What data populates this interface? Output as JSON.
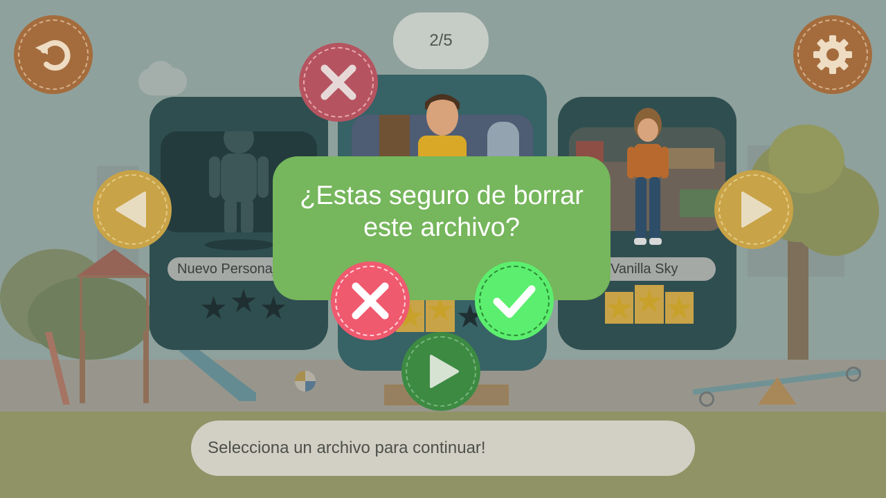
{
  "counter": {
    "text": "2/5"
  },
  "cards": [
    {
      "name": "Nuevo Personaje",
      "stars_filled": 0,
      "stars_total": 3
    },
    {
      "name": "",
      "stars_filled": 2,
      "stars_total": 3
    },
    {
      "name": "Vanilla Sky",
      "stars_filled": 3,
      "stars_total": 3
    }
  ],
  "dialog": {
    "question": "¿Estas seguro de borrar este archivo?",
    "cancel_icon": "cross-icon",
    "confirm_icon": "check-icon"
  },
  "hint": {
    "text": "Selecciona un archivo para continuar!"
  },
  "icons": {
    "top_left": "undo-icon",
    "top_right": "gear-icon",
    "delete": "cross-icon",
    "prev": "arrow-left-icon",
    "next": "arrow-right-icon",
    "play": "play-icon"
  },
  "colors": {
    "dialog": "#76b65c",
    "cancel": "#ef5a6f",
    "confirm": "#5cee6e",
    "card": "#2f4e50"
  }
}
